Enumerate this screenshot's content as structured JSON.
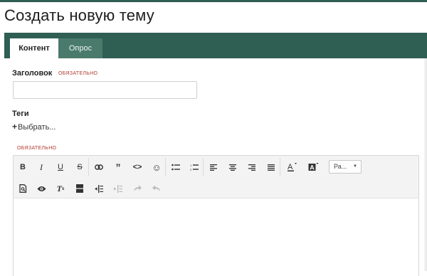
{
  "page": {
    "title": "Создать новую тему"
  },
  "tabs": [
    {
      "label": "Контент",
      "active": true
    },
    {
      "label": "Опрос",
      "active": false
    }
  ],
  "form": {
    "title_label": "Заголовок",
    "title_required": "ОБЯЗАТЕЛЬНО",
    "title_value": "",
    "tags_label": "Теги",
    "tags_choose": "Выбрать...",
    "content_required": "ОБЯЗАТЕЛЬНО"
  },
  "toolbar": {
    "row1": [
      "bold-icon",
      "italic-icon",
      "underline-icon",
      "strikethrough-icon",
      "link-icon",
      "quote-icon",
      "code-icon",
      "emoji-icon",
      "bulleted-list-icon",
      "numbered-list-icon",
      "align-left-icon",
      "align-center-icon",
      "align-right-icon",
      "justify-icon",
      "text-color-icon",
      "background-color-icon"
    ],
    "font_size_value": "Ра...",
    "row2": [
      "preview-doc-icon",
      "preview-eye-icon",
      "clear-format-icon",
      "page-break-icon",
      "indent-icon",
      "outdent-icon",
      "redo-icon",
      "undo-icon"
    ]
  },
  "colors": {
    "accent": "#2f5e52",
    "required": "#b23a2e"
  }
}
